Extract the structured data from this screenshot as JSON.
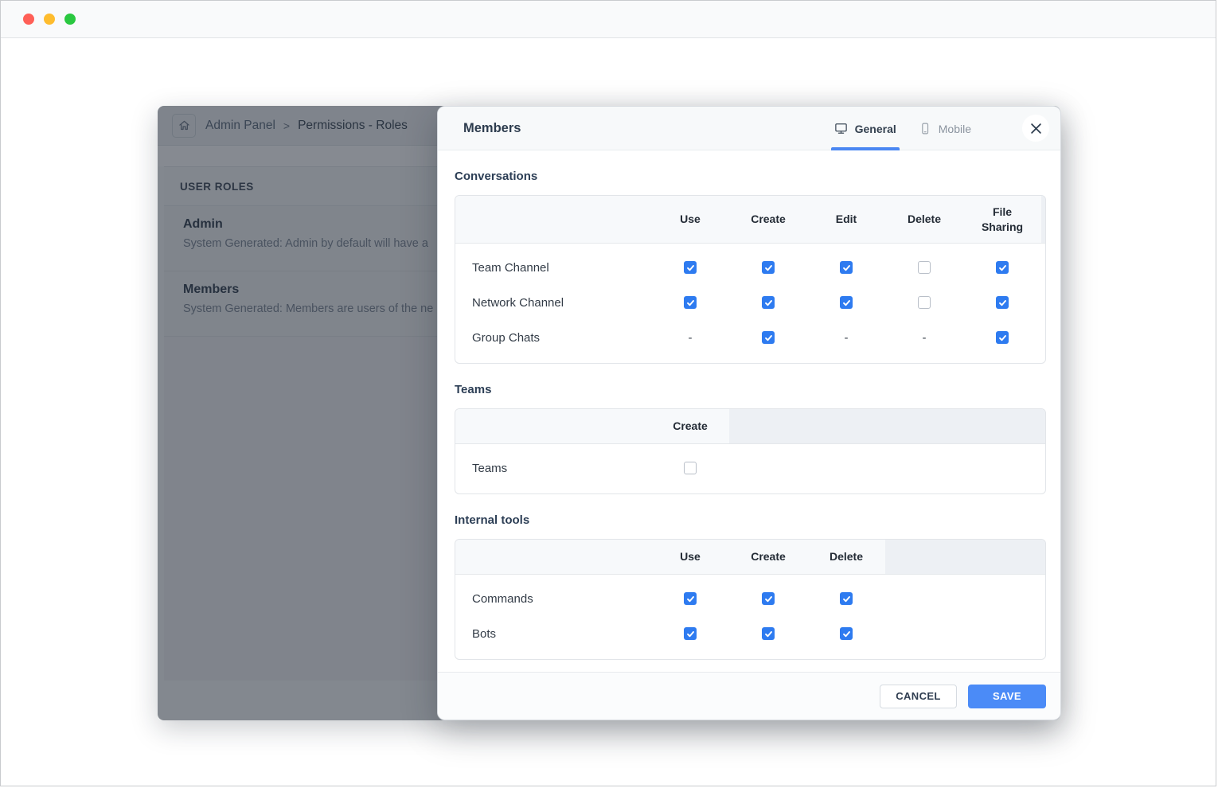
{
  "window_controls": {
    "close": "close",
    "minimize": "minimize",
    "zoom": "zoom"
  },
  "breadcrumb": {
    "home_icon": "home-icon",
    "items": [
      "Admin Panel",
      "Permissions - Roles"
    ],
    "separator": ">"
  },
  "sidebar": {
    "header": "USER ROLES",
    "roles": [
      {
        "name": "Admin",
        "description": "System Generated: Admin by default will have a"
      },
      {
        "name": "Members",
        "description": "System Generated: Members are users of the ne"
      }
    ]
  },
  "modal": {
    "title": "Members",
    "tabs": [
      {
        "label": "General",
        "icon": "monitor-icon",
        "active": true
      },
      {
        "label": "Mobile",
        "icon": "smartphone-icon",
        "active": false
      }
    ],
    "close_icon": "close-icon",
    "sections": [
      {
        "heading": "Conversations",
        "columns": [
          "Use",
          "Create",
          "Edit",
          "Delete",
          "File Sharing"
        ],
        "rows": [
          {
            "label": "Team Channel",
            "values": [
              "checked",
              "checked",
              "checked",
              "unchecked",
              "checked"
            ]
          },
          {
            "label": "Network Channel",
            "values": [
              "checked",
              "checked",
              "checked",
              "unchecked",
              "checked"
            ]
          },
          {
            "label": "Group Chats",
            "values": [
              "dash",
              "checked",
              "dash",
              "dash",
              "checked"
            ]
          }
        ]
      },
      {
        "heading": "Teams",
        "columns": [
          "Create"
        ],
        "rows": [
          {
            "label": "Teams",
            "values": [
              "unchecked"
            ]
          }
        ]
      },
      {
        "heading": "Internal tools",
        "columns": [
          "Use",
          "Create",
          "Delete"
        ],
        "rows": [
          {
            "label": "Commands",
            "values": [
              "checked",
              "checked",
              "checked"
            ]
          },
          {
            "label": "Bots",
            "values": [
              "checked",
              "checked",
              "checked"
            ]
          }
        ]
      }
    ],
    "footer": {
      "cancel": "CANCEL",
      "save": "SAVE"
    }
  },
  "colors": {
    "checkbox_checked": "#2e7bf0",
    "save_button": "#4b8bf7",
    "tab_underline": "#4a87f2",
    "traffic_red": "#ff5f57",
    "traffic_yellow": "#febc2e",
    "traffic_green": "#2ac840"
  },
  "dash_symbol": "-"
}
